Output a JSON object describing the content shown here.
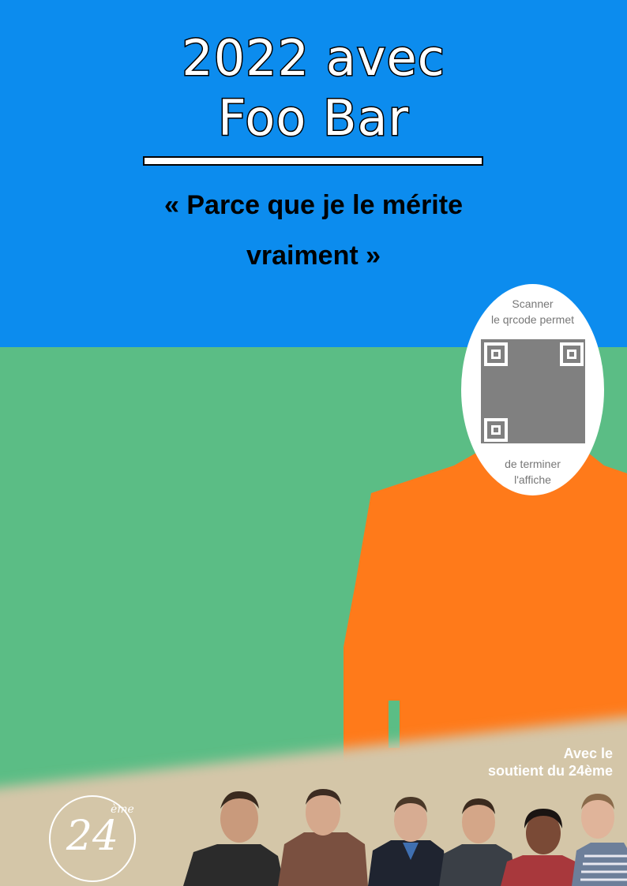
{
  "title": {
    "line1": "2022 avec",
    "line2": "Foo Bar"
  },
  "slogan": {
    "line1": "« Parce que je le mérite",
    "line2": "vraiment »"
  },
  "qr_prompt": {
    "top_line1": "Scanner",
    "top_line2": "le qrcode permet",
    "bottom_line1": "de terminer",
    "bottom_line2": "l'affiche"
  },
  "support": {
    "line1": "Avec le",
    "line2": "soutient du 24ème"
  },
  "logo": {
    "number": "24",
    "suffix": "ème"
  },
  "colors": {
    "sky": "#0c8cee",
    "grass": "#5bbd85",
    "silhouette": "#ff7a1a",
    "ground": "#d4c6a8",
    "title_fill": "#ffffff",
    "title_stroke": "#000000"
  },
  "icons": {
    "qr": "qr-code-icon",
    "logo": "24eme-logo-icon",
    "team": "team-photo-icon"
  }
}
